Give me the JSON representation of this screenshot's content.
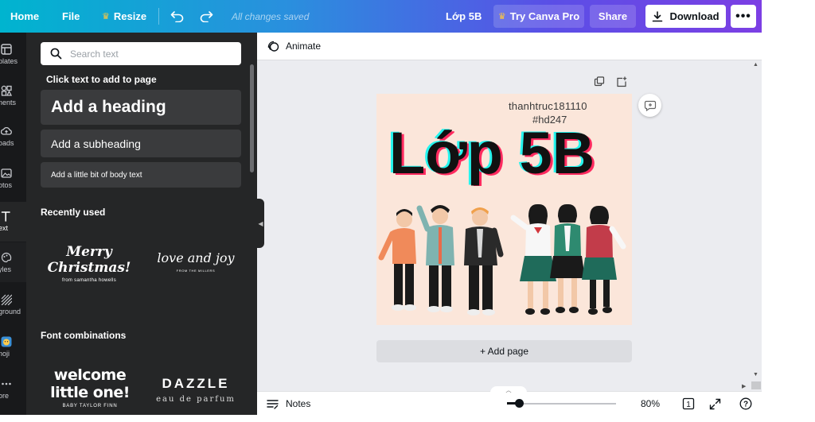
{
  "topbar": {
    "home": "Home",
    "file": "File",
    "resize": "Resize",
    "saved_status": "All changes saved",
    "design_title": "Lớp 5B",
    "try_pro": "Try Canva Pro",
    "share": "Share",
    "download": "Download",
    "more": "•••"
  },
  "rail": {
    "items": [
      {
        "label": "plates",
        "icon": "templates-icon"
      },
      {
        "label": "nents",
        "icon": "elements-icon"
      },
      {
        "label": "oads",
        "icon": "uploads-icon"
      },
      {
        "label": "otos",
        "icon": "photos-icon"
      },
      {
        "label": "ext",
        "icon": "text-icon",
        "active": true
      },
      {
        "label": "yles",
        "icon": "styles-icon"
      },
      {
        "label": "ground",
        "icon": "background-icon"
      },
      {
        "label": "noji",
        "icon": "emoji-icon"
      },
      {
        "label": "ore",
        "icon": "more-icon"
      }
    ]
  },
  "text_panel": {
    "search_placeholder": "Search text",
    "click_hint": "Click text to add to page",
    "add_heading": "Add a heading",
    "add_subheading": "Add a subheading",
    "add_body": "Add a little bit of body text",
    "recently_used": "Recently used",
    "font_combinations": "Font combinations",
    "samples": {
      "merry_line1": "Merry",
      "merry_line2": "Christmas!",
      "merry_small": "from samantha howells",
      "love": "love and joy",
      "love_small": "FROM THE MILLERS",
      "welcome_line1": "welcome",
      "welcome_line2": "little one!",
      "welcome_small": "BABY TAYLOR FINN",
      "dazzle": "DAZZLE",
      "dazzle_small": "eau de parfum"
    }
  },
  "editor": {
    "animate": "Animate",
    "add_page": "+ Add page",
    "design": {
      "username": "thanhtruc181110",
      "hashtag": "#hd247",
      "title": "Lớp 5B",
      "background": "#fbe6da"
    }
  },
  "footer": {
    "notes": "Notes",
    "zoom": "80%",
    "zoom_fraction": 0.08,
    "page_count": "1",
    "help": "?"
  },
  "colors": {
    "gradient_start": "#00b4cf",
    "gradient_end": "#7c3fe4",
    "panel_bg": "#252627",
    "rail_bg": "#18191b",
    "crown": "#ffc83d"
  }
}
